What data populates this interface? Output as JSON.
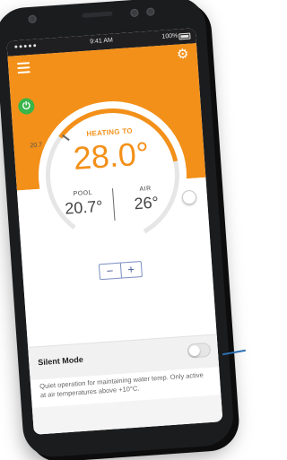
{
  "status_bar": {
    "carrier": "●●●●● ",
    "time": "9:41 AM",
    "battery": "100%"
  },
  "header": {
    "menu_icon": "hamburger-icon",
    "settings_icon": "gear-icon",
    "power_icon": "power-icon"
  },
  "dial": {
    "min_value": "20.7",
    "mode_label": "HEATING TO",
    "target_temp": "28.0°",
    "pool_label": "POOL",
    "pool_value": "20.7°",
    "air_label": "AIR",
    "air_value": "26°"
  },
  "stepper": {
    "minus": "−",
    "plus": "+"
  },
  "silent": {
    "label": "Silent Mode",
    "enabled": false,
    "description": "Quiet operation for maintaining water temp. Only active at air temperatures above +10°C."
  },
  "colors": {
    "accent": "#f39019",
    "power": "#39b54a",
    "stepper": "#4a5c96"
  }
}
